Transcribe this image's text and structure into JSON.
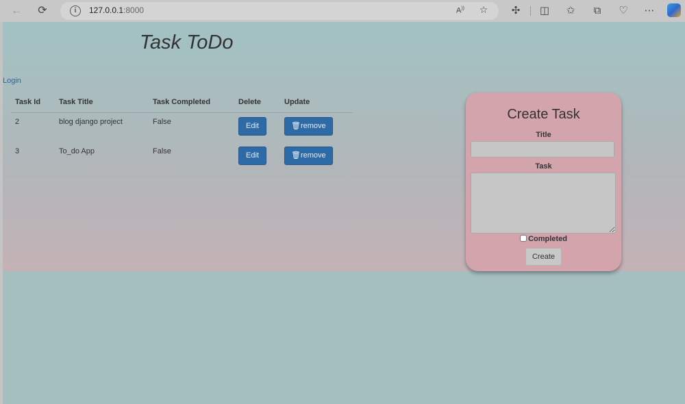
{
  "browser": {
    "url_host": "127.0.0.1",
    "url_port": ":8000"
  },
  "page": {
    "title": "Task ToDo",
    "login_link": "Login"
  },
  "table": {
    "headers": {
      "id": "Task Id",
      "title": "Task Title",
      "completed": "Task Completed",
      "delete": "Delete",
      "update": "Update"
    },
    "rows": [
      {
        "id": "2",
        "title": "blog django project",
        "completed": "False",
        "edit_label": "Edit",
        "remove_label": "remove"
      },
      {
        "id": "3",
        "title": "To_do App",
        "completed": "False",
        "edit_label": "Edit",
        "remove_label": "remove"
      }
    ]
  },
  "create_form": {
    "heading": "Create Task",
    "title_label": "Title",
    "title_value": "",
    "task_label": "Task",
    "task_value": "",
    "completed_label": "Completed",
    "completed_checked": false,
    "submit_label": "Create"
  },
  "colors": {
    "button_primary": "#2e6aa6",
    "card_bg": "#d3a4ac",
    "link": "#2a64a8"
  },
  "icons": [
    "back-arrow-icon",
    "refresh-icon",
    "info-icon",
    "read-aloud-icon",
    "favorite-star-icon",
    "extensions-icon",
    "split-screen-icon",
    "favorites-icon",
    "collections-icon",
    "browser-essentials-icon",
    "more-icon",
    "copilot-icon",
    "trash-icon"
  ]
}
